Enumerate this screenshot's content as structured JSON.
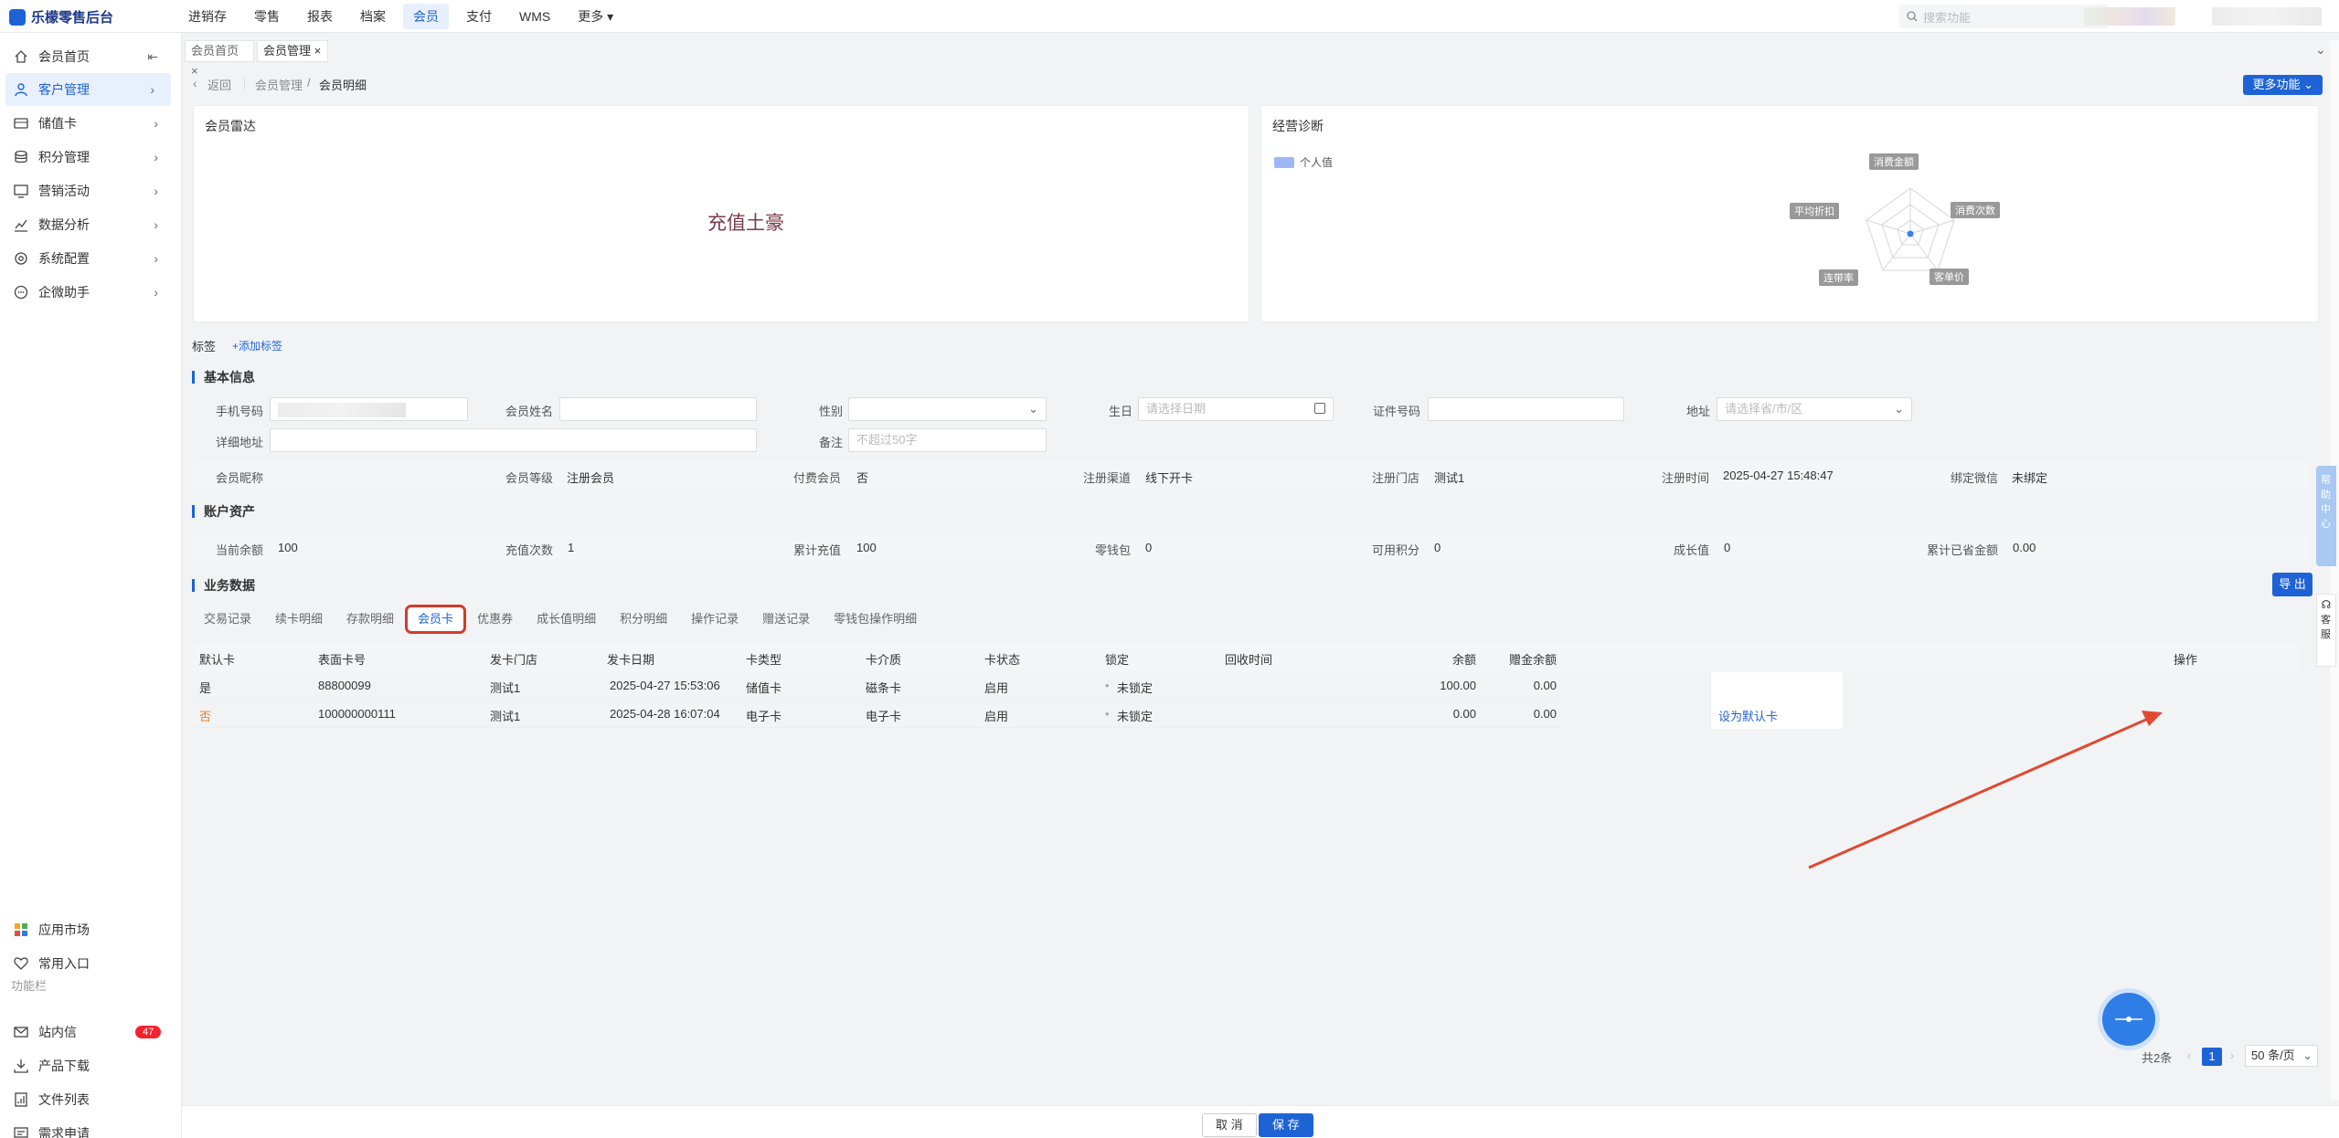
{
  "app": {
    "title": "乐檬零售后台"
  },
  "topnav": [
    "进销存",
    "零售",
    "报表",
    "档案",
    "会员",
    "支付",
    "WMS",
    "更多"
  ],
  "topnav_active": "会员",
  "search": {
    "placeholder": "搜索功能"
  },
  "sidebar": {
    "items": [
      {
        "label": "会员首页",
        "icon": "home-icon"
      },
      {
        "label": "客户管理",
        "icon": "user-icon",
        "active": true
      },
      {
        "label": "储值卡",
        "icon": "card-icon"
      },
      {
        "label": "积分管理",
        "icon": "coins-icon"
      },
      {
        "label": "营销活动",
        "icon": "monitor-icon"
      },
      {
        "label": "数据分析",
        "icon": "chart-icon"
      },
      {
        "label": "系统配置",
        "icon": "settings-icon"
      },
      {
        "label": "企微助手",
        "icon": "chat-icon"
      }
    ],
    "bottom": [
      {
        "label": "应用市场",
        "icon": "grid-icon"
      },
      {
        "label": "常用入口",
        "icon": "heart-icon"
      }
    ],
    "section_label": "功能栏",
    "tools": [
      {
        "label": "站内信",
        "icon": "mail-icon",
        "badge": "47"
      },
      {
        "label": "产品下载",
        "icon": "download-icon"
      },
      {
        "label": "文件列表",
        "icon": "file-icon"
      },
      {
        "label": "需求申请",
        "icon": "request-icon"
      }
    ]
  },
  "page_tabs": [
    {
      "label": "会员首页",
      "close": "×"
    },
    {
      "label": "会员管理",
      "close": "×"
    }
  ],
  "breadcrumb": {
    "back": "返回",
    "level1": "会员管理",
    "sep": "/",
    "level2": "会员明细"
  },
  "more_button": "更多功能",
  "radar_card": {
    "title": "会员雷达",
    "tag": "充值土豪"
  },
  "diag_card": {
    "title": "经营诊断",
    "legend": "个人值",
    "axes": [
      "消费金额",
      "消费次数",
      "客单价",
      "连带率",
      "平均折扣"
    ]
  },
  "tags": {
    "label": "标签",
    "add": "+添加标签"
  },
  "basic": {
    "title": "基本信息",
    "phone_label": "手机号码",
    "name_label": "会员姓名",
    "gender_label": "性别",
    "birthday_label": "生日",
    "birthday_placeholder": "请选择日期",
    "id_label": "证件号码",
    "address_label": "地址",
    "address_placeholder": "请选择省/市/区",
    "detail_address_label": "详细地址",
    "remark_label": "备注",
    "remark_placeholder": "不超过50字"
  },
  "info_row": [
    {
      "label": "会员昵称",
      "value": ""
    },
    {
      "label": "会员等级",
      "value": "注册会员"
    },
    {
      "label": "付费会员",
      "value": "否"
    },
    {
      "label": "注册渠道",
      "value": "线下开卡"
    },
    {
      "label": "注册门店",
      "value": "测试1"
    },
    {
      "label": "注册时间",
      "value": "2025-04-27 15:48:47"
    },
    {
      "label": "绑定微信",
      "value": "未绑定"
    }
  ],
  "assets": {
    "title": "账户资产",
    "items": [
      {
        "label": "当前余额",
        "value": "100"
      },
      {
        "label": "充值次数",
        "value": "1"
      },
      {
        "label": "累计充值",
        "value": "100"
      },
      {
        "label": "零钱包",
        "value": "0"
      },
      {
        "label": "可用积分",
        "value": "0"
      },
      {
        "label": "成长值",
        "value": "0"
      },
      {
        "label": "累计已省金额",
        "value": "0.00"
      }
    ]
  },
  "business": {
    "title": "业务数据",
    "export": "导 出",
    "tabs": [
      "交易记录",
      "续卡明细",
      "存款明细",
      "会员卡",
      "优惠券",
      "成长值明细",
      "积分明细",
      "操作记录",
      "赠送记录",
      "零钱包操作明细"
    ],
    "active_tab": "会员卡"
  },
  "table": {
    "headers": [
      "默认卡",
      "表面卡号",
      "发卡门店",
      "发卡日期",
      "卡类型",
      "卡介质",
      "卡状态",
      "锁定",
      "回收时间",
      "余额",
      "赠金余额",
      "操作"
    ],
    "rows": [
      {
        "default": "是",
        "card_no": "88800099",
        "store": "测试1",
        "date": "2025-04-27 15:53:06",
        "type": "储值卡",
        "medium": "磁条卡",
        "status": "启用",
        "lock": "未锁定",
        "recycle": "",
        "balance": "100.00",
        "gift": "0.00",
        "op": ""
      },
      {
        "default": "否",
        "card_no": "100000000111",
        "store": "测试1",
        "date": "2025-04-28 16:07:04",
        "type": "电子卡",
        "medium": "电子卡",
        "status": "启用",
        "lock": "未锁定",
        "recycle": "",
        "balance": "0.00",
        "gift": "0.00",
        "op": "设为默认卡"
      }
    ]
  },
  "pager": {
    "total": "共2条",
    "current": "1",
    "size": "50 条/页"
  },
  "footer": {
    "cancel": "取 消",
    "save": "保 存"
  },
  "side_rail": {
    "label1": "帮助中心",
    "label2": "客服"
  },
  "colors": {
    "primary": "#1e63d6",
    "highlight": "#d43a2a",
    "warn": "#f07a1e"
  }
}
